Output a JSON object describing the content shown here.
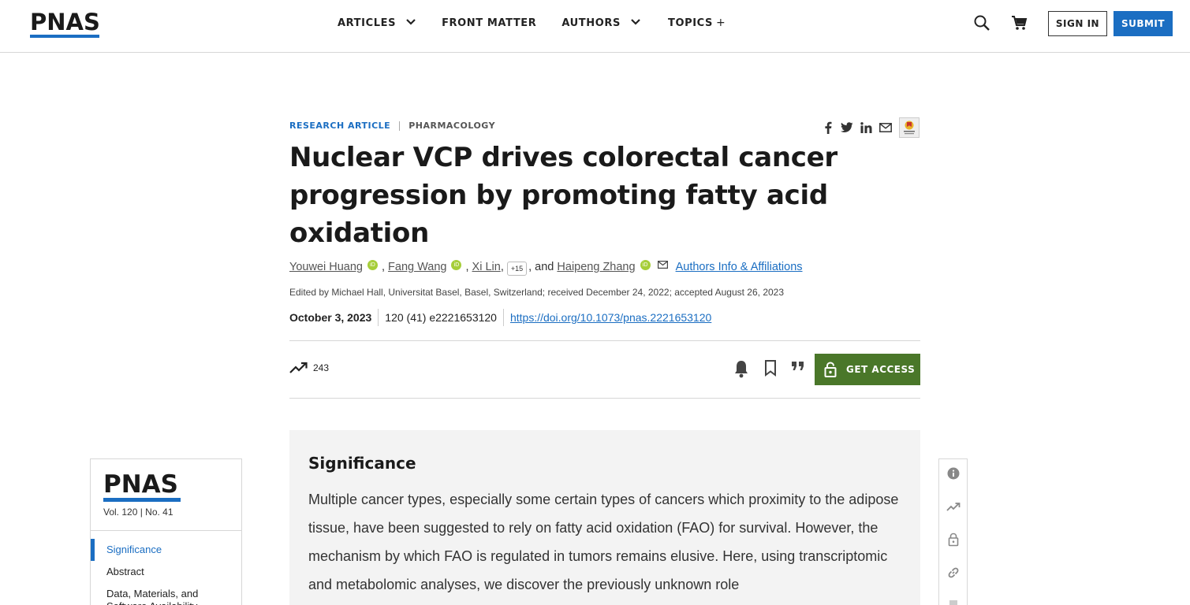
{
  "header": {
    "logo": "PNAS",
    "nav": [
      {
        "label": "ARTICLES",
        "has_dropdown": true
      },
      {
        "label": "FRONT MATTER",
        "has_dropdown": false
      },
      {
        "label": "AUTHORS",
        "has_dropdown": true
      },
      {
        "label": "TOPICS",
        "has_dropdown": false,
        "suffix": "+"
      }
    ],
    "sign_in": "SIGN IN",
    "submit": "SUBMIT"
  },
  "article": {
    "type": "RESEARCH ARTICLE",
    "subject": "PHARMACOLOGY",
    "title": "Nuclear VCP drives colorectal cancer progression by promoting fatty acid oxidation",
    "authors": [
      {
        "name": "Youwei Huang"
      },
      {
        "name": "Fang Wang"
      },
      {
        "name": "Xi Lin"
      },
      {
        "name": "Haipeng Zhang"
      }
    ],
    "more_authors": "+15",
    "and_text": ", and",
    "affiliations_link": "Authors Info & Affiliations",
    "edited_by": "Edited by Michael Hall, Universitat Basel, Basel, Switzerland; received December 24, 2022; accepted August 26, 2023",
    "date": "October 3, 2023",
    "volume": "120 (41) e2221653120",
    "doi": "https://doi.org/10.1073/pnas.2221653120",
    "metric_count": "243",
    "get_access": "GET ACCESS"
  },
  "significance": {
    "heading": "Significance",
    "text": "Multiple cancer types, especially some certain types of cancers which proximity to the adipose tissue, have been suggested to rely on fatty acid oxidation (FAO) for survival. However, the mechanism by which FAO is regulated in tumors remains elusive. Here, using transcriptomic and metabolomic analyses, we discover the previously unknown role"
  },
  "sidebar": {
    "logo": "PNAS",
    "volume": "Vol. 120 | No. 41",
    "toc": [
      {
        "label": "Significance",
        "active": true
      },
      {
        "label": "Abstract",
        "active": false
      },
      {
        "label": "Data, Materials, and Software Availability",
        "active": false
      }
    ]
  },
  "colors": {
    "brand_blue": "#1b6ec2",
    "access_green": "#4a7729",
    "orcid_green": "#a6ce39"
  }
}
